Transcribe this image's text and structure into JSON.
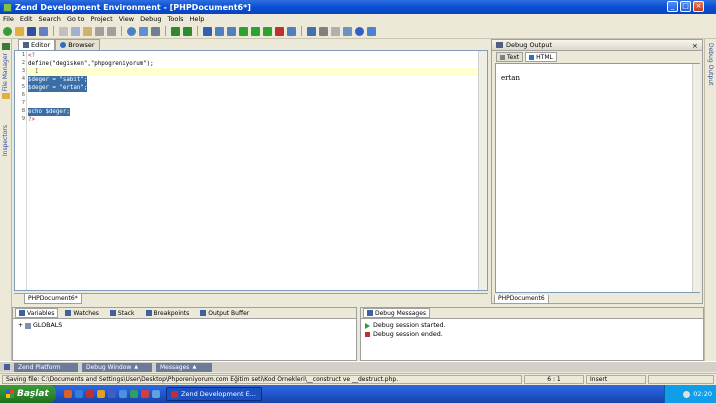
{
  "window": {
    "title": "Zend Development Environment - [PHPDocument6*]"
  },
  "menu": [
    "File",
    "Edit",
    "Search",
    "Go to",
    "Project",
    "View",
    "Debug",
    "Tools",
    "Help"
  ],
  "left_strip": {
    "file_manager": "File Manager",
    "inspectors": "Inspectors"
  },
  "right_strip": {
    "debug_output": "Debug Output"
  },
  "editor": {
    "tabs": [
      "Editor",
      "Browser"
    ],
    "lines": [
      {
        "n": "1",
        "text": "<?"
      },
      {
        "n": "2",
        "text": "define(\"degisken\",\"phpogreniyorum\");"
      },
      {
        "n": "3",
        "text": "  I"
      },
      {
        "n": "4",
        "text": "$deger = \"sabit\";"
      },
      {
        "n": "5",
        "text": "$deger = \"ertan\";"
      },
      {
        "n": "6",
        "text": ""
      },
      {
        "n": "7",
        "text": ""
      },
      {
        "n": "8",
        "text": "echo $deger;"
      },
      {
        "n": "9",
        "text": "?>"
      }
    ],
    "document_tab": "PHPDocument6*"
  },
  "debug_output": {
    "title": "Debug Output",
    "tabs": [
      "Text",
      "HTML"
    ],
    "output": "ertan",
    "document_tab": "PHPDocument6"
  },
  "bottom_left": {
    "tabs": [
      "Variables",
      "Watches",
      "Stack",
      "Breakpoints",
      "Output Buffer"
    ],
    "tree_root": "GLOBALS"
  },
  "bottom_right": {
    "tab": "Debug Messages",
    "messages": [
      "Debug session started.",
      "Debug session ended."
    ]
  },
  "inner_taskbar": [
    "Zend Platform",
    "Debug Window",
    "Messages"
  ],
  "status": {
    "message": "Saving file: C:\\Documents and Settings\\User\\Desktop\\Phporeniyorum.com Eğitim seti\\Kod Örnekleri\\__construct ve __destruct.php.",
    "position": "6 : 1",
    "mode": "Insert"
  },
  "taskbar": {
    "start": "Başlat",
    "task": "Zend Development E...",
    "clock": "02:20"
  },
  "colors": {
    "selection": "#3a6ea5",
    "title": "#0a4fd4",
    "current_line": "#ffffd0"
  }
}
